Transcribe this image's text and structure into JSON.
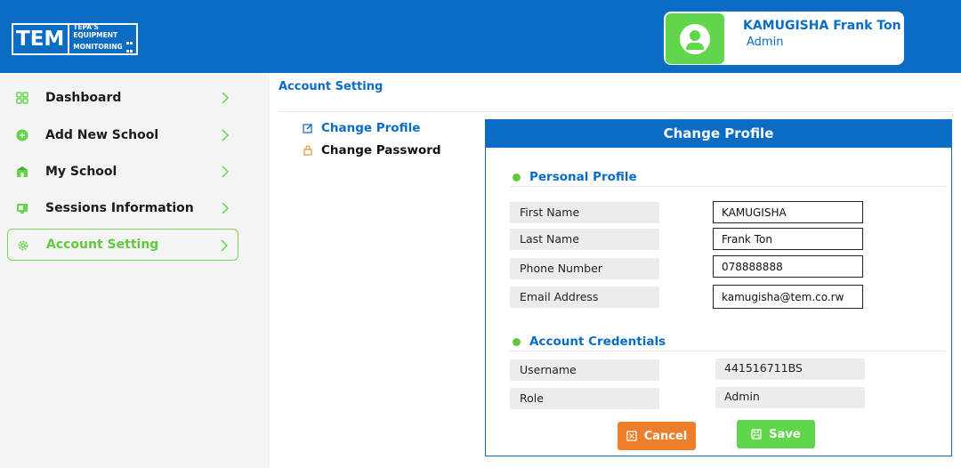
{
  "app": {
    "logo_main": "TEM",
    "logo_line1": "TEPA'S",
    "logo_line2": "EQUIPMENT",
    "logo_line3": "MONITORING"
  },
  "user": {
    "name": "KAMUGISHA Frank Ton",
    "role": "Admin",
    "avatar_icon": "user-circle-icon"
  },
  "sidebar": {
    "items": [
      {
        "label": "Dashboard",
        "icon": "dashboard-grid-icon",
        "active": false
      },
      {
        "label": "Add New School",
        "icon": "plus-circle-icon",
        "active": false
      },
      {
        "label": "My School",
        "icon": "school-building-icon",
        "active": false
      },
      {
        "label": "Sessions Information",
        "icon": "sessions-icon",
        "active": false
      },
      {
        "label": "Account Setting",
        "icon": "gear-icon",
        "active": true
      }
    ]
  },
  "page": {
    "title": "Account Setting"
  },
  "submenu": {
    "change_profile": "Change Profile",
    "change_password": "Change Password"
  },
  "panel": {
    "title": "Change Profile",
    "personal_title": "Personal Profile",
    "credentials_title": "Account Credentials",
    "fields": [
      {
        "label": "First Name",
        "value": "KAMUGISHA"
      },
      {
        "label": "Last Name",
        "value": "Frank Ton"
      },
      {
        "label": "Phone Number",
        "value": "078888888"
      },
      {
        "label": "Email Address",
        "value": "kamugisha@tem.co.rw"
      }
    ],
    "credentials": [
      {
        "label": "Username",
        "value": "441516711BS"
      },
      {
        "label": "Role",
        "value": "Admin"
      }
    ],
    "cancel_label": "Cancel",
    "save_label": "Save"
  },
  "colors": {
    "primary": "#0b6cc4",
    "accent_green": "#61d64a",
    "cancel_orange": "#ed7f2c",
    "sidebar_bg": "#f4f4f4"
  }
}
